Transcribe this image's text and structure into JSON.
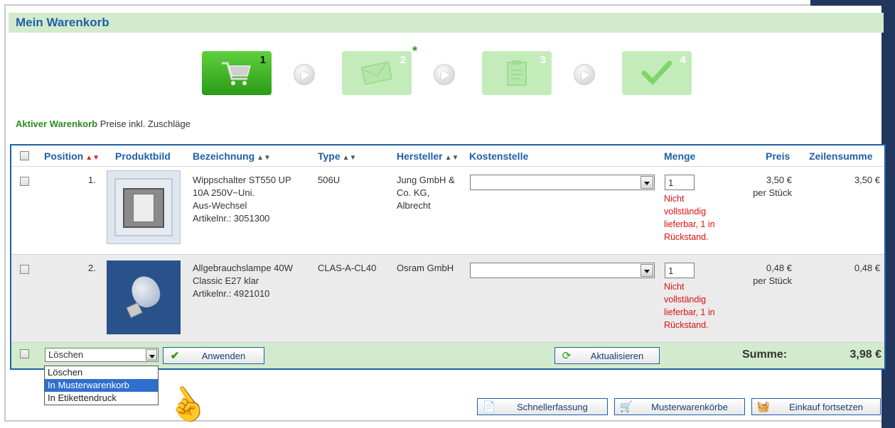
{
  "page": {
    "title": "Mein Warenkorb"
  },
  "steps": [
    {
      "num": "1",
      "icon": "shopping-cart-icon",
      "active": true,
      "star": ""
    },
    {
      "num": "2",
      "icon": "envelope-icon",
      "active": false,
      "star": "*"
    },
    {
      "num": "3",
      "icon": "clipboard-icon",
      "active": false,
      "star": ""
    },
    {
      "num": "4",
      "icon": "checkmark-icon",
      "active": false,
      "star": ""
    }
  ],
  "cart": {
    "active_label": "Aktiver Warenkorb",
    "prices_note": "Preise inkl. Zuschläge"
  },
  "table": {
    "headers": {
      "position": "Position",
      "image": "Produktbild",
      "designation": "Bezeichnung",
      "type": "Type",
      "manufacturer": "Hersteller",
      "cost_center": "Kostenstelle",
      "quantity": "Menge",
      "price": "Preis",
      "line_total": "Zeilensumme"
    },
    "rows": [
      {
        "position": "1.",
        "image_icon": "wall-switch-product-image",
        "designation": [
          "Wippschalter ST550 UP",
          "10A 250V~Uni.",
          "Aus-Wechsel",
          "Artikelnr.: 3051300"
        ],
        "type": "506U",
        "manufacturer": [
          "Jung GmbH &",
          "Co. KG,",
          "Albrecht"
        ],
        "cost_center": "",
        "quantity": "1",
        "warning": [
          "Nicht",
          "vollständig",
          "lieferbar, 1 in",
          "Rückstand."
        ],
        "price": "3,50 €",
        "price_unit": "per Stück",
        "line_total": "3,50 €"
      },
      {
        "position": "2.",
        "image_icon": "light-bulb-product-image",
        "designation": [
          "Allgebrauchslampe 40W",
          "Classic E27 klar",
          "Artikelnr.: 4921010"
        ],
        "type": "CLAS-A-CL40",
        "manufacturer": [
          "Osram GmbH"
        ],
        "cost_center": "",
        "quantity": "1",
        "warning": [
          "Nicht",
          "vollständig",
          "lieferbar, 1 in",
          "Rückstand."
        ],
        "price": "0,48 €",
        "price_unit": "per Stück",
        "line_total": "0,48 €"
      }
    ]
  },
  "footer": {
    "action_select_value": "Löschen",
    "action_options": [
      "Löschen",
      "In Musterwarenkorb",
      "In Etikettendruck"
    ],
    "action_selected_index": 1,
    "apply_label": "Anwenden",
    "refresh_label": "Aktualisieren",
    "sum_label": "Summe:",
    "sum_value": "3,98 €"
  },
  "bottom_buttons": {
    "quick_entry": "Schnellerfassung",
    "sample_carts": "Musterwarenkörbe",
    "continue_shopping": "Einkauf fortsetzen"
  },
  "colors": {
    "accent_blue": "#1f5fa8",
    "light_green": "#d2ebcc",
    "active_green": "#2b9b16",
    "warning_red": "#e01010",
    "sort_red": "#d9241a"
  }
}
